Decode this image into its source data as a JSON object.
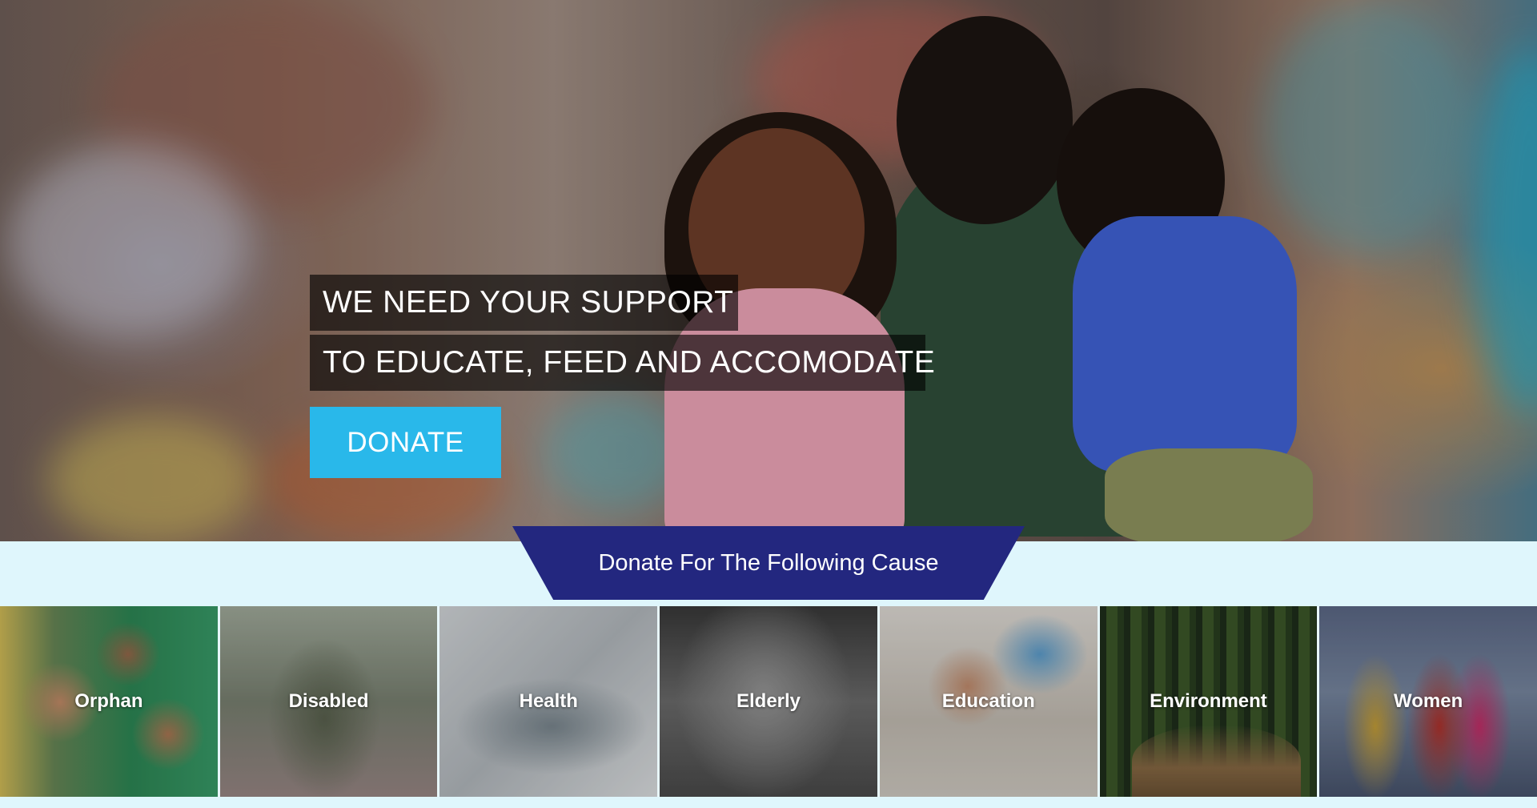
{
  "hero": {
    "line1": "WE NEED YOUR SUPPORT",
    "line2": "TO EDUCATE, FEED AND ACCOMODATE",
    "donate_label": "DONATE"
  },
  "causes": {
    "heading": "Donate For The Following Cause",
    "items": [
      {
        "label": "Orphan"
      },
      {
        "label": "Disabled"
      },
      {
        "label": "Health"
      },
      {
        "label": "Elderly"
      },
      {
        "label": "Education"
      },
      {
        "label": "Environment"
      },
      {
        "label": "Women"
      }
    ]
  },
  "colors": {
    "donate_button": "#29b8ea",
    "banner": "#23277f",
    "band_background": "#dff6fc"
  }
}
